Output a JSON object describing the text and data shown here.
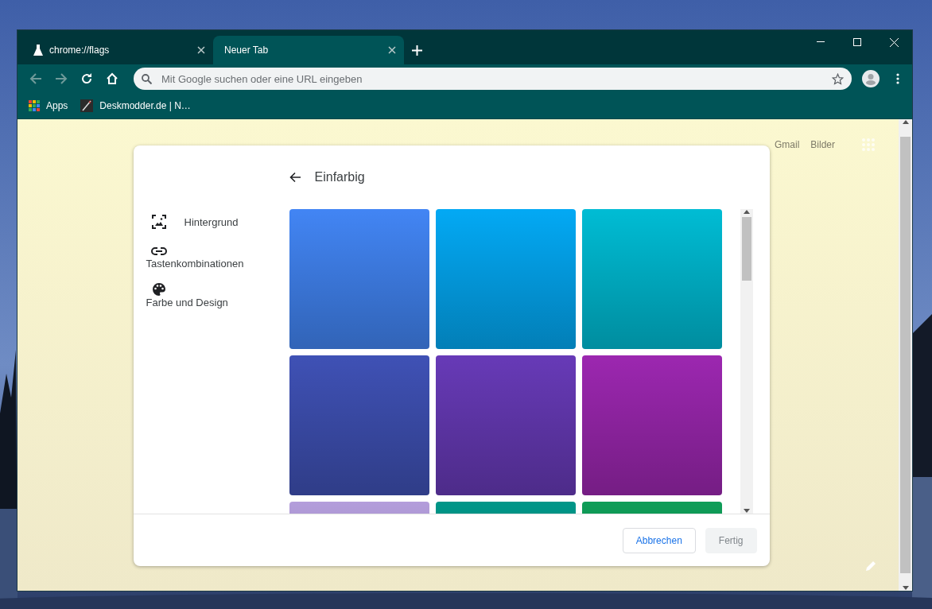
{
  "browser": {
    "tabs": [
      {
        "title": "chrome://flags",
        "selected": false,
        "kind": "flags"
      },
      {
        "title": "Neuer Tab",
        "selected": true,
        "kind": "plain"
      }
    ],
    "omnibox": {
      "placeholder": "Mit Google suchen oder eine URL eingeben"
    },
    "bookmarks": [
      {
        "label": "Apps",
        "kind": "apps"
      },
      {
        "label": "Deskmodder.de | N…",
        "kind": "site"
      }
    ]
  },
  "page": {
    "top_links": [
      "Gmail",
      "Bilder"
    ]
  },
  "dialog": {
    "title": "Einfarbig",
    "nav": [
      {
        "label": "Hintergrund",
        "kind": "background"
      },
      {
        "label": "Tastenkombinationen",
        "kind": "shortcuts"
      },
      {
        "label": "Farbe und Design",
        "kind": "colors"
      }
    ],
    "swatches": [
      {
        "color": "#4285f4"
      },
      {
        "color": "#03a9f4"
      },
      {
        "color": "#00bcd4"
      },
      {
        "color": "#3f51b5"
      },
      {
        "color": "#673ab7"
      },
      {
        "color": "#9c27b0"
      },
      {
        "color": "#b39ddb"
      },
      {
        "color": "#009688"
      },
      {
        "color": "#0f9d58"
      }
    ],
    "buttons": [
      {
        "label": "Abbrechen",
        "disabled": false
      },
      {
        "label": "Fertig",
        "disabled": true
      }
    ]
  }
}
